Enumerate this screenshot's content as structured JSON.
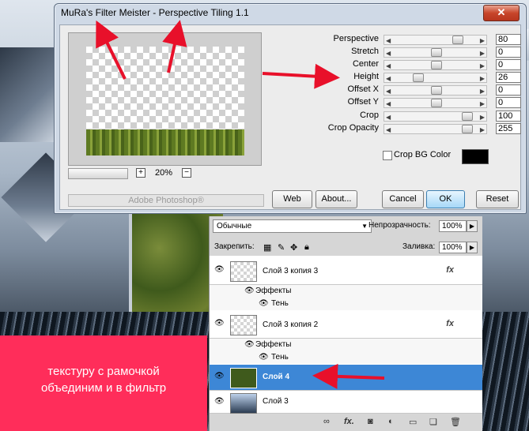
{
  "dialog": {
    "title": "MuRa's Filter Meister - Perspective Tiling 1.1",
    "close_glyph": "✕",
    "zoom": {
      "value": "20%",
      "plus": "+",
      "minus": "−"
    },
    "brand_label": "Adobe Photoshop®",
    "params": [
      {
        "label": "Perspective",
        "value": "80",
        "level": 0.8
      },
      {
        "label": "Stretch",
        "value": "0",
        "level": 0.5
      },
      {
        "label": "Center",
        "value": "0",
        "level": 0.5
      },
      {
        "label": "Height",
        "value": "26",
        "level": 0.26
      },
      {
        "label": "Offset X",
        "value": "0",
        "level": 0.5
      },
      {
        "label": "Offset Y",
        "value": "0",
        "level": 0.5
      },
      {
        "label": "Crop",
        "value": "100",
        "level": 0.92
      },
      {
        "label": "Crop Opacity",
        "value": "255",
        "level": 0.92
      }
    ],
    "crop_bg_label": "Crop BG Color",
    "crop_bg_color": "#000000",
    "buttons": {
      "web": "Web",
      "about": "About...",
      "cancel": "Cancel",
      "ok": "OK",
      "reset": "Reset"
    }
  },
  "layers_panel": {
    "blend_mode": "Обычные",
    "opacity_label": "Непрозрачность:",
    "opacity_value": "100%",
    "lock_label": "Закрепить:",
    "fill_label": "Заливка:",
    "fill_value": "100%",
    "layers": [
      {
        "name": "Слой 3 копия 3",
        "fx": "fx",
        "effects": "Эффекты",
        "shadow": "Тень"
      },
      {
        "name": "Слой 3 копия 2",
        "fx": "fx",
        "effects": "Эффекты",
        "shadow": "Тень"
      },
      {
        "name": "Слой 4",
        "selected": true
      },
      {
        "name": "Слой 3"
      }
    ]
  },
  "caption": {
    "line1": "текстуру с рамочкой",
    "line2": "объединим и в фильтр"
  },
  "colors": {
    "accent_arrow": "#e8102a",
    "caption_bg": "#ff2d5a",
    "selected_layer": "#3d87d6"
  }
}
